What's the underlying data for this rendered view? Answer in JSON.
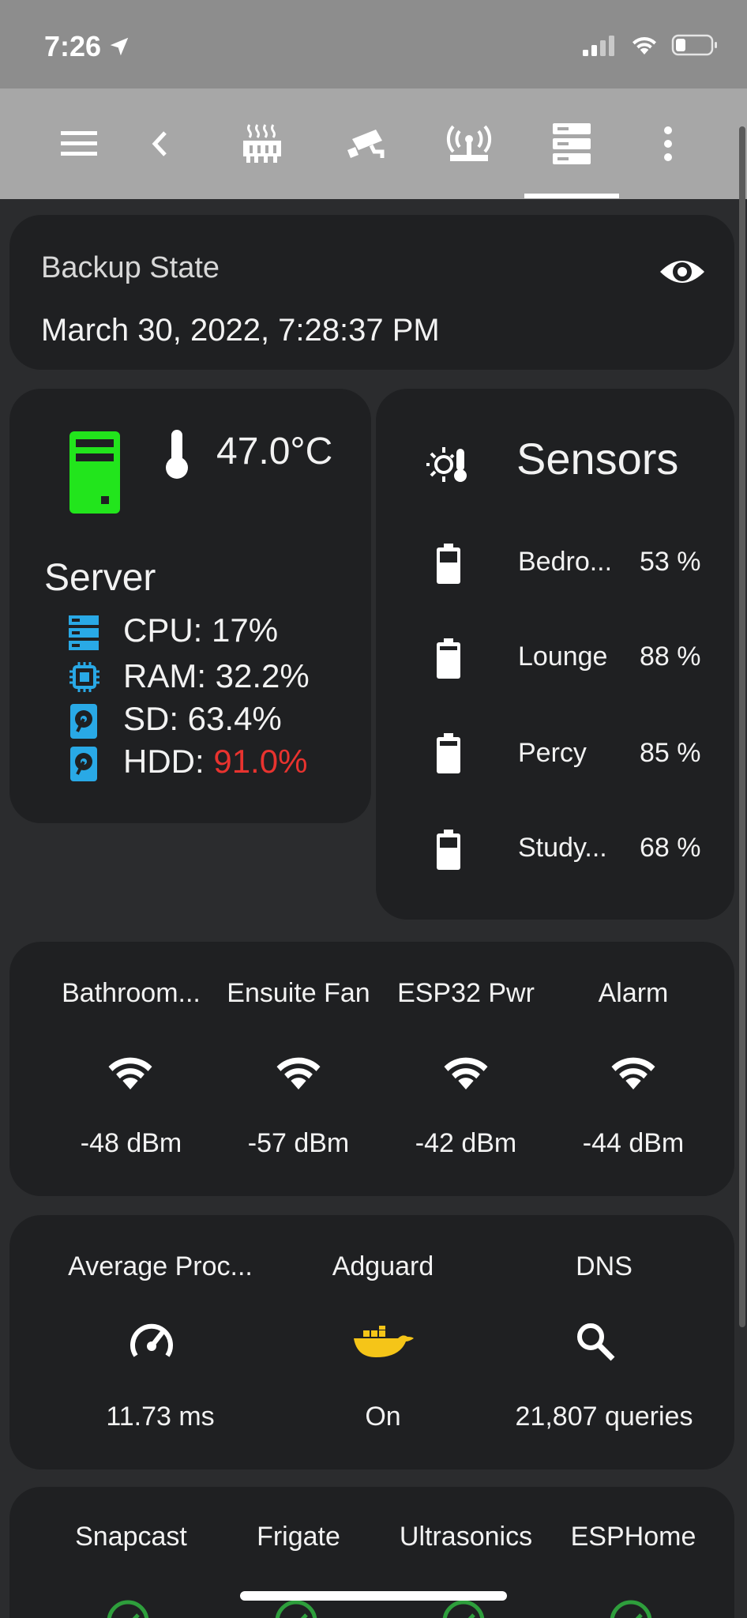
{
  "status": {
    "time": "7:26"
  },
  "backup": {
    "title": "Backup State",
    "value": "March 30, 2022, 7:28:37 PM"
  },
  "server": {
    "temperature": "47.0°C",
    "title": "Server",
    "cpu": "CPU: 17%",
    "ram": "RAM: 32.2%",
    "sd": "SD: 63.4%",
    "hdd_label": "HDD: ",
    "hdd_value": "91.0%",
    "hdd_color": "#e8332f",
    "server_color": "#22e51c"
  },
  "sensors": {
    "title": "Sensors",
    "items": [
      {
        "name": "Bedro...",
        "value": "53 %"
      },
      {
        "name": "Lounge",
        "value": "88 %"
      },
      {
        "name": "Percy",
        "value": "85 %"
      },
      {
        "name": "Study...",
        "value": "68 %"
      }
    ]
  },
  "wifi": {
    "items": [
      {
        "name": "Bathroom...",
        "value": "-48 dBm"
      },
      {
        "name": "Ensuite Fan",
        "value": "-57 dBm"
      },
      {
        "name": "ESP32 Pwr",
        "value": "-42 dBm"
      },
      {
        "name": "Alarm",
        "value": "-44 dBm"
      }
    ]
  },
  "adguard": {
    "items": [
      {
        "name": "Average Proc...",
        "value": "11.73 ms",
        "icon": "speedometer-icon"
      },
      {
        "name": "Adguard",
        "value": "On",
        "icon": "docker-icon"
      },
      {
        "name": "DNS",
        "value": "21,807 queries",
        "icon": "search-icon"
      }
    ]
  },
  "services": {
    "items": [
      {
        "name": "Snapcast"
      },
      {
        "name": "Frigate"
      },
      {
        "name": "Ultrasonics"
      },
      {
        "name": "ESPHome"
      }
    ]
  },
  "colors": {
    "accent_blue": "#29a9e6",
    "docker_yellow": "#f5c518",
    "ok_green": "#2e9e3c"
  }
}
